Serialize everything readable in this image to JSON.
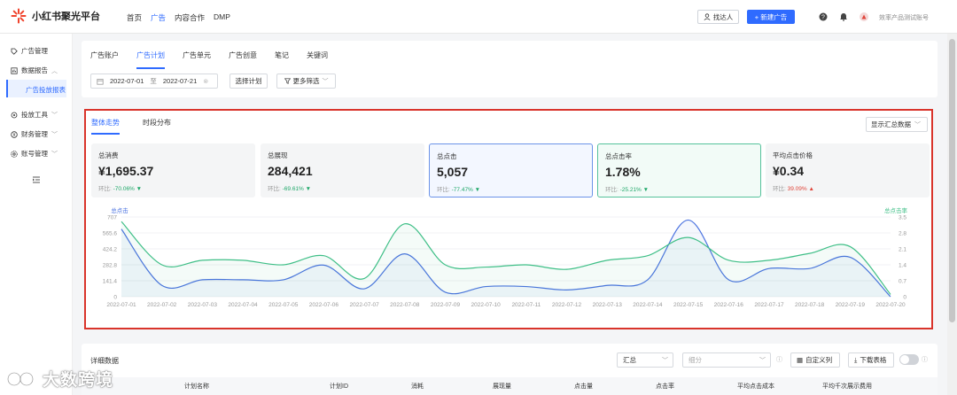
{
  "app": {
    "name": "小红书聚光平台"
  },
  "nav": [
    "首页",
    "广告",
    "内容合作",
    "DMP"
  ],
  "topbar": {
    "find_label": "找达人",
    "new_ad_label": "+ 新建广告",
    "account": "效率产品测试账号"
  },
  "sidebar": {
    "items": [
      {
        "label": "广告管理"
      },
      {
        "label": "数据报告"
      },
      {
        "label": "投放工具"
      },
      {
        "label": "财务管理"
      },
      {
        "label": "账号管理"
      }
    ],
    "sub_item": "广告投放报表"
  },
  "tabs": [
    "广告账户",
    "广告计划",
    "广告单元",
    "广告创意",
    "笔记",
    "关键词"
  ],
  "filters": {
    "date_start": "2022-07-01",
    "date_sep": "至",
    "date_end": "2022-07-21",
    "select_plan": "选择计划",
    "more_filter": "更多筛选"
  },
  "chart_tabs": [
    "整体走势",
    "时段分布"
  ],
  "show_summary": "显示汇总数据",
  "kpis": [
    {
      "title": "总消费",
      "value": "¥1,695.37",
      "ratio_label": "环比:",
      "ratio": "-70.06%",
      "dir": "down"
    },
    {
      "title": "总展现",
      "value": "284,421",
      "ratio_label": "环比:",
      "ratio": "-69.61%",
      "dir": "down"
    },
    {
      "title": "总点击",
      "value": "5,057",
      "ratio_label": "环比:",
      "ratio": "-77.47%",
      "dir": "down"
    },
    {
      "title": "总点击率",
      "value": "1.78%",
      "ratio_label": "环比:",
      "ratio": "-25.21%",
      "dir": "down"
    },
    {
      "title": "平均点击价格",
      "value": "¥0.34",
      "ratio_label": "环比:",
      "ratio": "39.09%",
      "dir": "up"
    }
  ],
  "chart_data": {
    "type": "line",
    "x": [
      "2022-07-01",
      "2022-07-02",
      "2022-07-03",
      "2022-07-04",
      "2022-07-05",
      "2022-07-06",
      "2022-07-07",
      "2022-07-08",
      "2022-07-09",
      "2022-07-10",
      "2022-07-11",
      "2022-07-12",
      "2022-07-13",
      "2022-07-14",
      "2022-07-15",
      "2022-07-16",
      "2022-07-17",
      "2022-07-18",
      "2022-07-19",
      "2022-07-20"
    ],
    "series": [
      {
        "name": "总点击",
        "axis": "left",
        "color": "#4a72e0",
        "values": [
          600,
          100,
          150,
          150,
          150,
          280,
          70,
          380,
          40,
          90,
          90,
          60,
          100,
          150,
          680,
          150,
          250,
          250,
          350,
          0
        ]
      },
      {
        "name": "总点击率",
        "axis": "right",
        "color": "#3fbf87",
        "values": [
          3.3,
          1.4,
          1.6,
          1.6,
          1.4,
          1.8,
          0.8,
          3.2,
          1.4,
          1.3,
          1.4,
          1.2,
          1.6,
          1.8,
          2.6,
          1.6,
          1.6,
          1.9,
          2.2,
          0.1
        ]
      }
    ],
    "yleft": {
      "ticks": [
        "0",
        "141.4",
        "282.8",
        "424.2",
        "565.6",
        "707"
      ],
      "ylim": [
        0,
        707
      ]
    },
    "yright": {
      "ticks": [
        "0",
        "0.7",
        "1.4",
        "2.1",
        "2.8",
        "3.5"
      ],
      "ylim": [
        0,
        3.5
      ]
    },
    "grid": true
  },
  "detail": {
    "title": "详细数据",
    "agg": "汇总",
    "split": "细分",
    "custom_cols": "自定义列",
    "download": "下载表格"
  },
  "table_headers": [
    "计划名称",
    "计划ID",
    "消耗",
    "展现量",
    "点击量",
    "点击率",
    "平均点击成本",
    "平均千次展示费用"
  ],
  "watermark": "大数跨境"
}
